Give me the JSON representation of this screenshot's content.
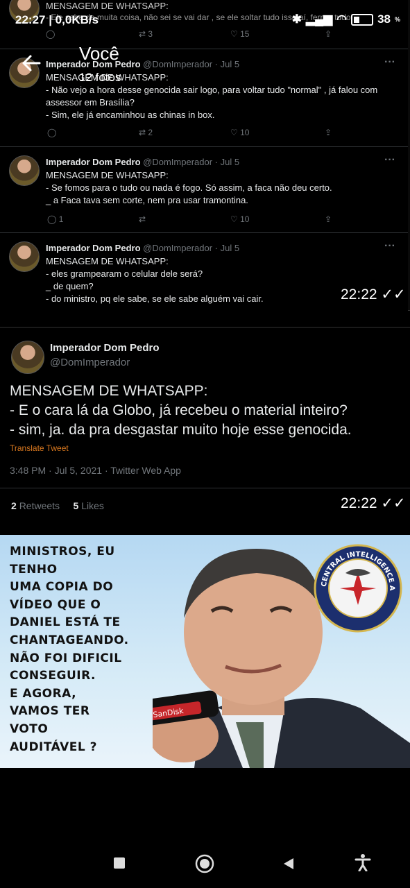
{
  "status_bar": {
    "time": "22:27 | 0,0KB/s",
    "battery": "38"
  },
  "header": {
    "title": "Você",
    "subtitle": "12 fotos"
  },
  "shot1": {
    "partial_top": {
      "text": "MENSAGEM DE WHATSAPP:",
      "line2": "- Ele sabe de muita coisa, não sei se vai dar , se ele soltar tudo isso aí, ferrou tudo...",
      "retweets": "3",
      "likes": "15"
    },
    "tweets": [
      {
        "name": "Imperador Dom Pedro",
        "meta": "@DomImperador · Jul 5",
        "text": "MENSAGEM DE WHATSAPP:\n- Não vejo a hora desse genocida sair logo, para voltar tudo \"normal\" , já falou com assessor em Brasília?\n- Sim, ele já encaminhou as chinas in box.",
        "replies": "",
        "retweets": "2",
        "likes": "10"
      },
      {
        "name": "Imperador Dom Pedro",
        "meta": "@DomImperador · Jul 5",
        "text": "MENSAGEM DE WHATSAPP:\n- Se fomos para o tudo ou nada é fogo. Só assim, a faca não deu certo.\n_ a Faca tava sem corte, nem pra usar tramontina.",
        "replies": "1",
        "retweets": "",
        "likes": "10"
      },
      {
        "name": "Imperador Dom Pedro",
        "meta": "@DomImperador · Jul 5",
        "text": "MENSAGEM DE WHATSAPP:\n- eles grampearam o celular dele será?\n_ de quem?\n- do ministro, pq ele sabe, se ele sabe alguém vai cair."
      }
    ],
    "timestamp": "22:22"
  },
  "shot2": {
    "name": "Imperador Dom Pedro",
    "handle": "@DomImperador",
    "text": "MENSAGEM DE WHATSAPP:\n- E o cara lá da Globo, já recebeu o material inteiro?\n- sim, ja. da pra desgastar muito hoje esse genocida.",
    "translate": "Translate Tweet",
    "meta": "3:48 PM · Jul 5, 2021 · Twitter Web App",
    "retweets": "2",
    "retweets_label": "Retweets",
    "likes": "5",
    "likes_label": "Likes",
    "timestamp": "22:22"
  },
  "shot3": {
    "meme_text": "MINISTROS, EU TENHO\nUMA COPIA DO\nVÍDEO QUE O\nDANIEL ESTÁ TE\nCHANTAGEANDO.\nNÃO FOI DIFICIL\nCONSEGUIR.\nE AGORA,\nVAMOS TER\nVOTO\nAUDITÁVEL ?",
    "seal_text": "CENTRAL INTELLIGENCE AGENCY",
    "usb_brand": "SanDisk"
  },
  "colors": {
    "translate": "#d9781f",
    "twitter_gray": "#71767b"
  }
}
